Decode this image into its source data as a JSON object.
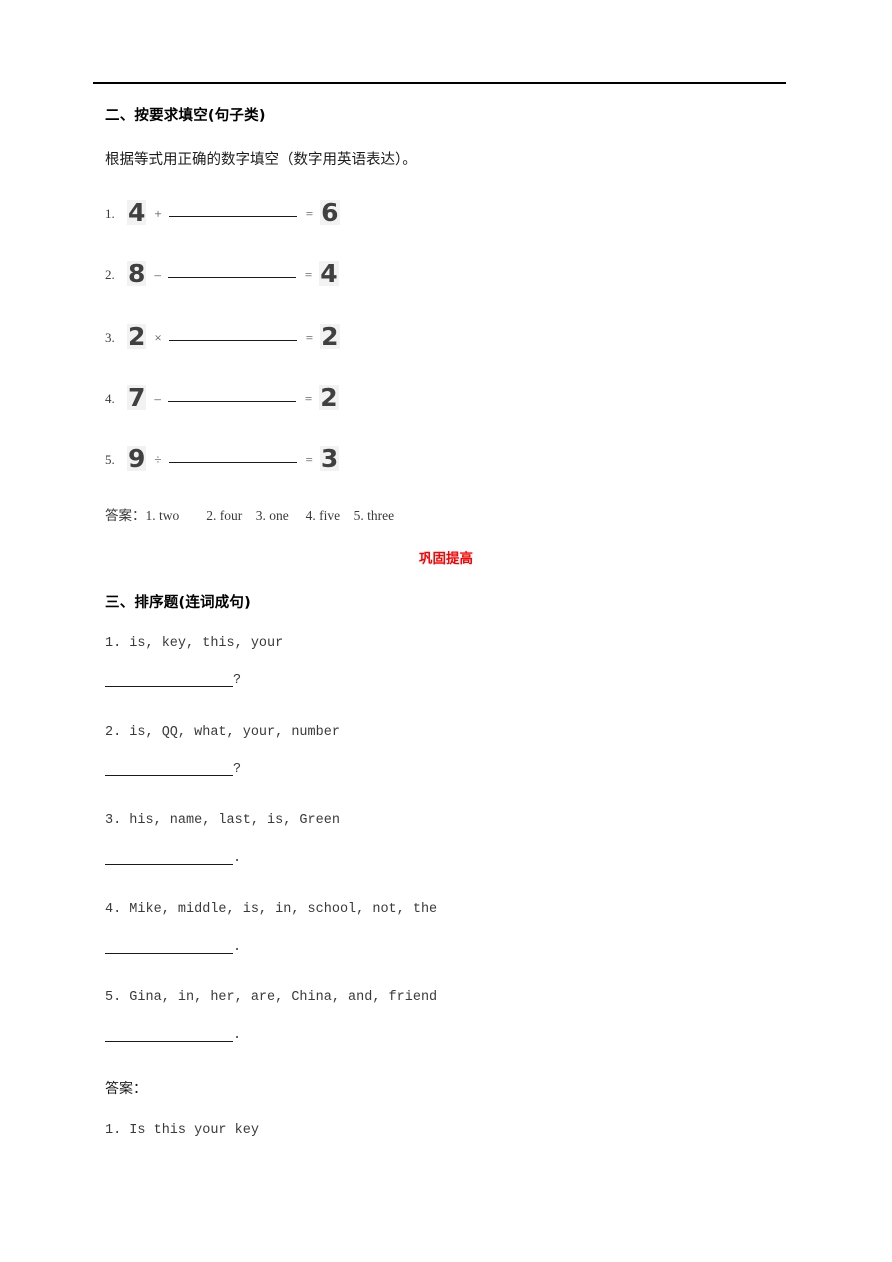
{
  "page": {
    "background": "#ffffff",
    "rule_color": "#000000"
  },
  "section_two": {
    "heading": "二、按要求填空(句子类)",
    "instruction": "根据等式用正确的数字填空（数字用英语表达）。",
    "equations": [
      {
        "index": "1.",
        "left": "4",
        "operator": "+",
        "result": "6",
        "blank_width": 128
      },
      {
        "index": "2.",
        "left": "8",
        "operator": "–",
        "result": "4",
        "blank_width": 128
      },
      {
        "index": "3.",
        "left": "2",
        "operator": "×",
        "result": "2",
        "blank_width": 128
      },
      {
        "index": "4.",
        "left": "7",
        "operator": "–",
        "result": "2",
        "blank_width": 128
      },
      {
        "index": "5.",
        "left": "9",
        "operator": "÷",
        "result": "3",
        "blank_width": 128
      }
    ],
    "answer_line": "答案：1. two        2. four    3. one     4. five    5. three"
  },
  "banner": {
    "text": "巩固提高",
    "color": "#ff0000"
  },
  "section_three": {
    "heading": "三、排序题(连词成句)",
    "items": [
      {
        "prompt": "1. is, key, this, your",
        "punct": "?"
      },
      {
        "prompt": "2. is, QQ, what, your, number",
        "punct": "?"
      },
      {
        "prompt": "3. his, name, last, is, Green",
        "punct": "."
      },
      {
        "prompt": "4. Mike, middle, is, in, school, not, the",
        "punct": "."
      },
      {
        "prompt": "5. Gina, in, her, are, China, and, friend",
        "punct": "."
      }
    ],
    "answer_label": "答案：",
    "answers": [
      "1. Is this your key"
    ]
  }
}
